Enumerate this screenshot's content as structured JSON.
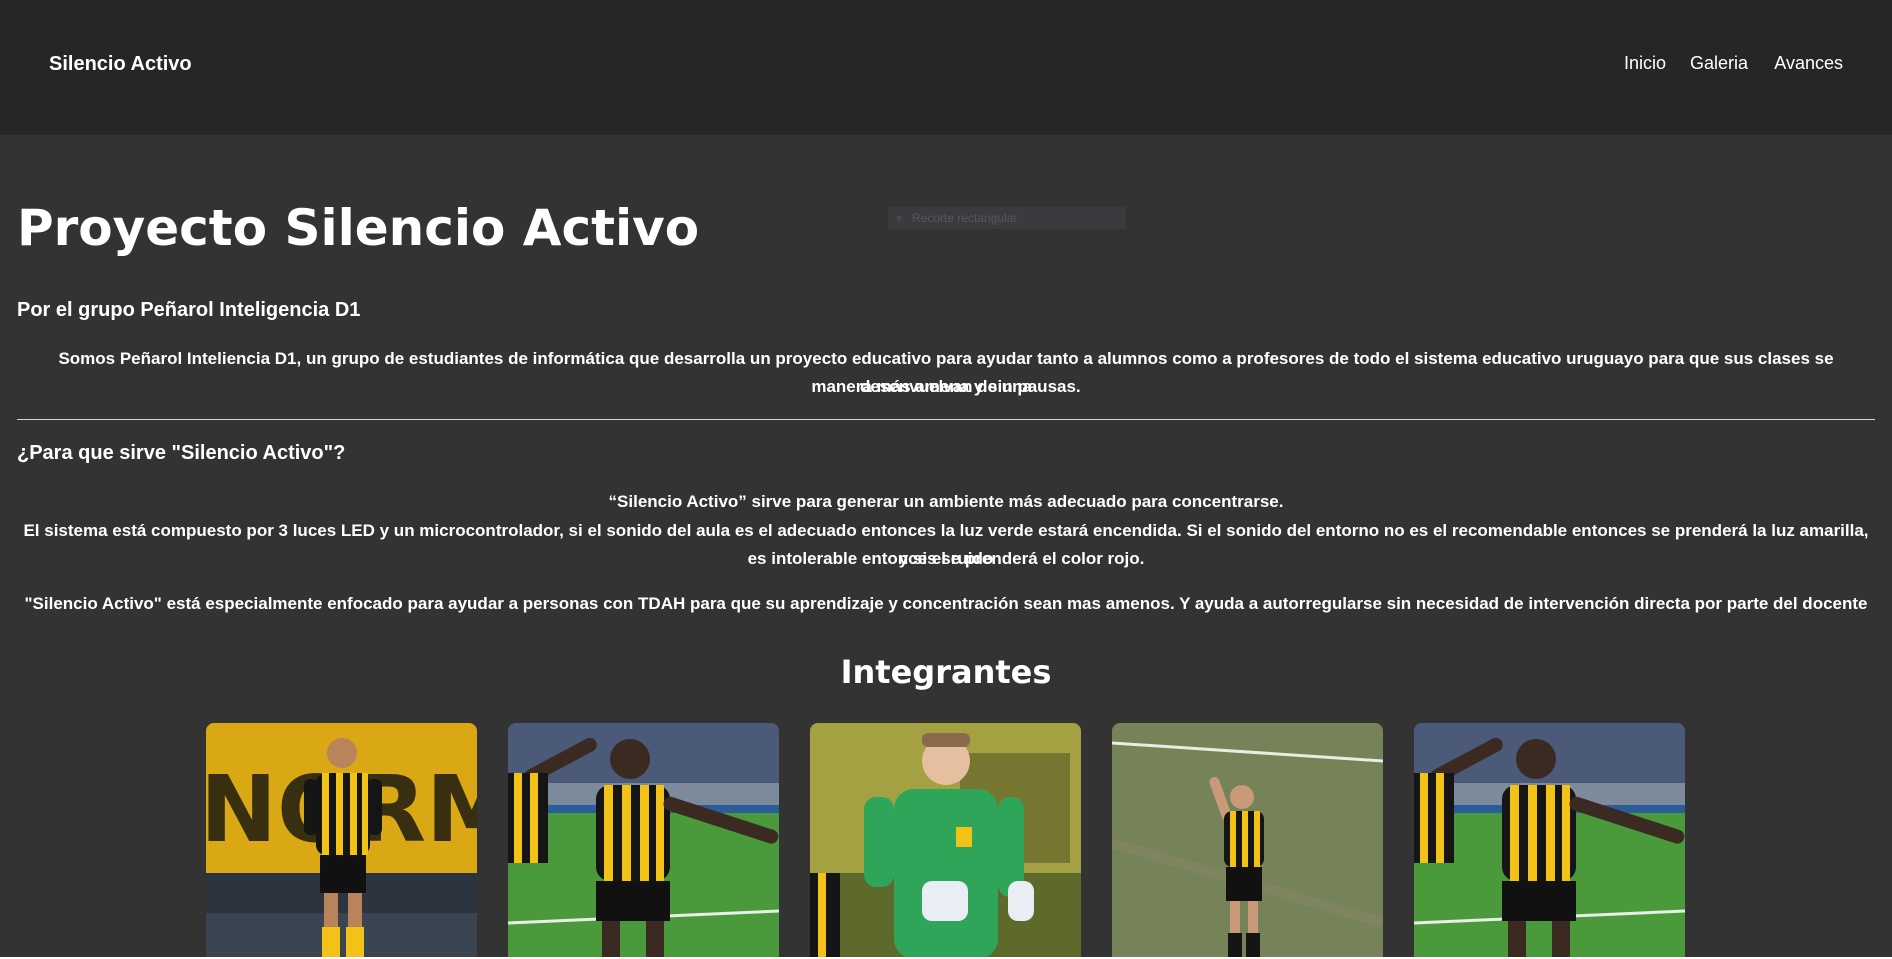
{
  "nav": {
    "brand": "Silencio Activo",
    "links": [
      {
        "label": "Inicio"
      },
      {
        "label": "Galeria"
      },
      {
        "label": "Avances"
      }
    ]
  },
  "overlay": {
    "label": "Recorte rectangular"
  },
  "hero": {
    "title": "Proyecto Silencio Activo",
    "subtitle": "Por el grupo Peñarol Inteligencia D1",
    "intro_line1": "Somos Peñarol Inteliencia D1, un grupo de estudiantes de informática que desarrolla un proyecto educativo para ayudar tanto a alumnos como a profesores de todo el sistema educativo uruguayo para que sus clases se desenvuelvan de una",
    "intro_line2": "manera más amena y sin pausas."
  },
  "purpose": {
    "heading": "¿Para que sirve \"Silencio Activo\"?",
    "line1": "“Silencio Activo” sirve para generar un ambiente más adecuado para concentrarse.",
    "line2": "El sistema está compuesto por 3 luces LED y un microcontrolador, si el sonido del aula es el adecuado entonces la luz verde estará encendida. Si el sonido del entorno no es el recomendable entonces se prenderá la luz amarilla, y si el ruido",
    "line3": "es intolerable entonces se prenderá el color rojo.",
    "line4": "\"Silencio Activo\" está especialmente enfocado para ayudar a personas con TDAH para que su aprendizaje y concentración sean mas amenos. Y ayuda a autorregularse sin necesidad de intervención directa por parte del docente"
  },
  "members": {
    "heading": "Integrantes",
    "cards": [
      {
        "photo": "player-yellow-black-kit-stadium"
      },
      {
        "photo": "player-celebrating-pitch"
      },
      {
        "photo": "goalkeeper-green-kit"
      },
      {
        "photo": "player-waving-pitch"
      },
      {
        "photo": "player-celebrating-pitch"
      }
    ]
  },
  "colors": {
    "page_bg": "#333333",
    "navbar_bg": "#272624",
    "text": "#ffffff",
    "kit_yellow": "#f2c316",
    "kit_black": "#151515",
    "grass": "#3f8a34",
    "gk_green": "#2fa55a"
  }
}
